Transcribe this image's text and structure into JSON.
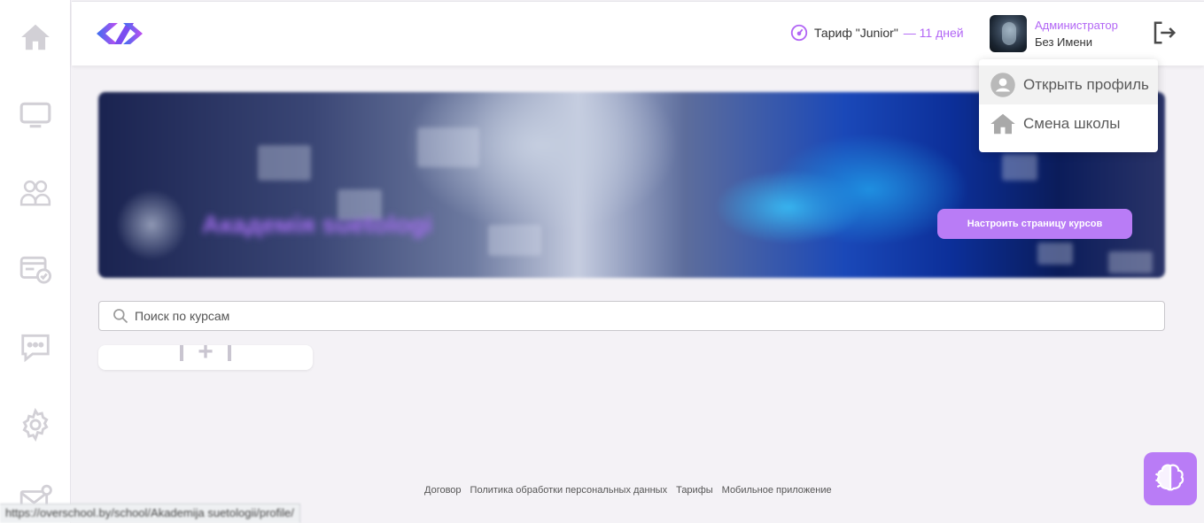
{
  "sidebar": {
    "items": [
      {
        "icon": "home-icon"
      },
      {
        "icon": "monitor-icon"
      },
      {
        "icon": "users-icon"
      },
      {
        "icon": "course-check-icon"
      },
      {
        "icon": "chat-icon"
      },
      {
        "icon": "gear-icon"
      },
      {
        "icon": "mail-icon"
      }
    ]
  },
  "header": {
    "tariff": {
      "name": "Тариф \"Junior\"",
      "days": "— 11 дней"
    },
    "user": {
      "role": "Администратор",
      "name": "Без Имени"
    }
  },
  "dropdown": {
    "items": [
      {
        "label": "Открыть профиль",
        "icon": "user-circle-icon"
      },
      {
        "label": "Смена школы",
        "icon": "home-icon"
      }
    ]
  },
  "banner": {
    "title": "Академія suetologi",
    "button_label": "Настроить страницу курсов"
  },
  "search": {
    "placeholder": "Поиск по курсам"
  },
  "footer": {
    "links": [
      "Договор",
      "Политика обработки персональных данных",
      "Тарифы",
      "Мобильное приложение"
    ]
  },
  "status_url": "https://overschool.by/school/Akademija suetologii/profile/",
  "colors": {
    "accent": "#b266f5",
    "button": "#b97cf6",
    "icon_gray": "#d5d3da"
  }
}
